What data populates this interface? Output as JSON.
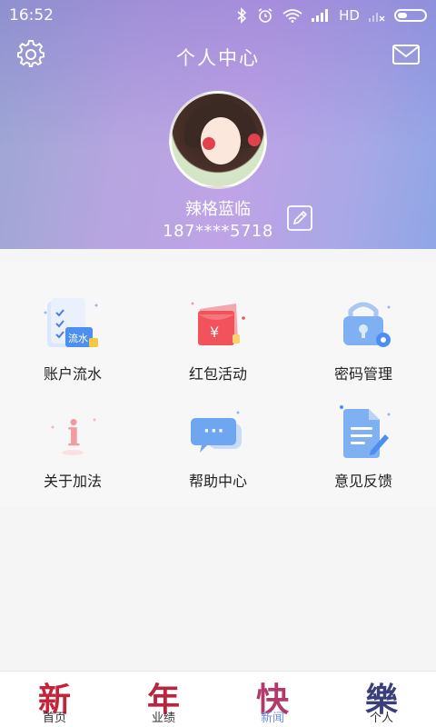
{
  "status_bar": {
    "time": "16:52",
    "network": "HD"
  },
  "header": {
    "title": "个人中心"
  },
  "profile": {
    "name": "辣格蓝临",
    "phone": "187****5718"
  },
  "menu": {
    "items": [
      {
        "label": "账户流水",
        "icon": "ledger-icon",
        "icon_text": "流水"
      },
      {
        "label": "红包活动",
        "icon": "red-envelope-icon",
        "icon_text": "¥"
      },
      {
        "label": "密码管理",
        "icon": "lock-icon"
      },
      {
        "label": "关于加法",
        "icon": "info-icon",
        "icon_text": "i"
      },
      {
        "label": "帮助中心",
        "icon": "chat-bubble-icon",
        "icon_text": "···"
      },
      {
        "label": "意见反馈",
        "icon": "feedback-document-icon"
      }
    ]
  },
  "tabbar": {
    "tabs": [
      {
        "glyph": "新",
        "label": "首页",
        "color": "#c4243a"
      },
      {
        "glyph": "年",
        "label": "业绩",
        "color": "#b8263d"
      },
      {
        "glyph": "快",
        "label": "新闻",
        "color": "#b23a6a"
      },
      {
        "glyph": "樂",
        "label": "个人",
        "color": "#3a3f7a"
      }
    ],
    "active_index": 2,
    "active_color": "#6d8fe0"
  },
  "colors": {
    "header_gradient_start": "#9aa7d3",
    "header_gradient_end": "#8fa6e6",
    "accent": "#6d8fe0"
  }
}
